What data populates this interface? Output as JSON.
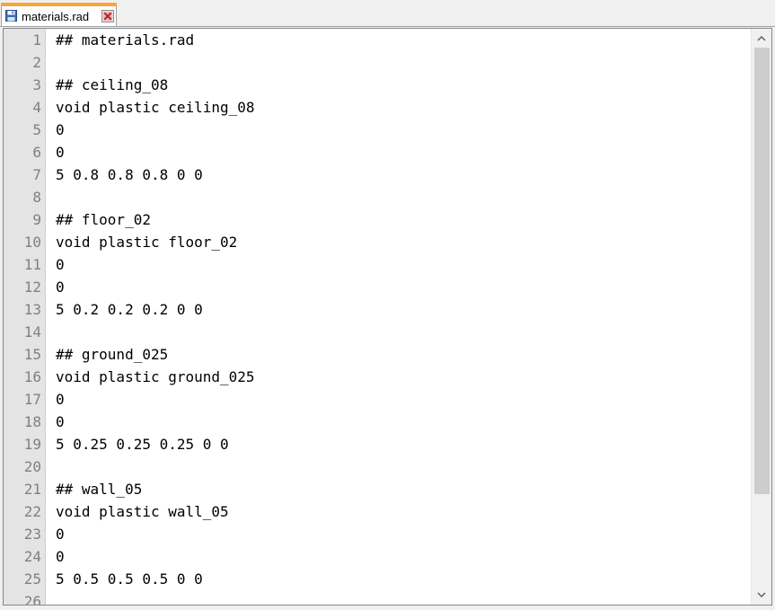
{
  "tab": {
    "label": "materials.rad",
    "icon": "save-icon",
    "close_icon": "close-icon",
    "accent_color": "#f8a53a"
  },
  "editor": {
    "line_numbers": [
      "1",
      "2",
      "3",
      "4",
      "5",
      "6",
      "7",
      "8",
      "9",
      "10",
      "11",
      "12",
      "13",
      "14",
      "15",
      "16",
      "17",
      "18",
      "19",
      "20",
      "21",
      "22",
      "23",
      "24",
      "25",
      "26"
    ],
    "lines": [
      "## materials.rad",
      "",
      "## ceiling_08",
      "void plastic ceiling_08",
      "0",
      "0",
      "5 0.8 0.8 0.8 0 0",
      "",
      "## floor_02",
      "void plastic floor_02",
      "0",
      "0",
      "5 0.2 0.2 0.2 0 0",
      "",
      "## ground_025",
      "void plastic ground_025",
      "0",
      "0",
      "5 0.25 0.25 0.25 0 0",
      "",
      "## wall_05",
      "void plastic wall_05",
      "0",
      "0",
      "5 0.5 0.5 0.5 0 0",
      ""
    ]
  },
  "scrollbar": {
    "up_icon": "chevron-up-icon",
    "down_icon": "chevron-down-icon",
    "position": 0
  }
}
